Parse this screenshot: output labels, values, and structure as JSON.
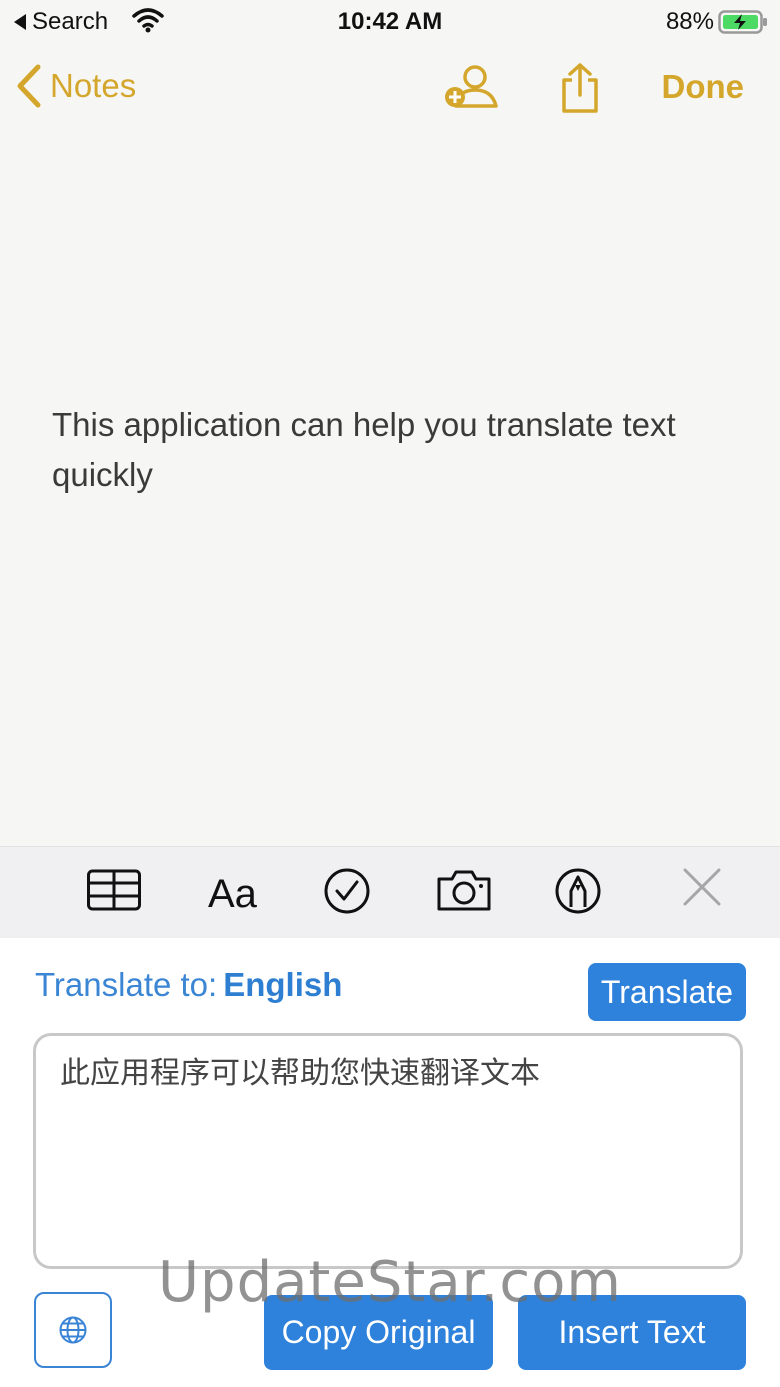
{
  "status_bar": {
    "back_app": "Search",
    "time": "10:42 AM",
    "battery_percent": "88%"
  },
  "nav": {
    "back_label": "Notes",
    "done_label": "Done",
    "accent_color": "#d4a72c"
  },
  "note": {
    "text": "This application can help you translate text quickly"
  },
  "toolbar": {
    "icons": [
      "table-icon",
      "text-format-icon",
      "checklist-icon",
      "camera-icon",
      "markup-icon",
      "close-icon"
    ]
  },
  "translator": {
    "label": "Translate to:",
    "target_language": "English",
    "translate_button": "Translate",
    "output_text": "此应用程序可以帮助您快速翻译文本",
    "copy_original_button": "Copy Original",
    "insert_text_button": "Insert Text",
    "accent_color": "#2f82dc"
  },
  "watermark": "UpdateStar.com"
}
